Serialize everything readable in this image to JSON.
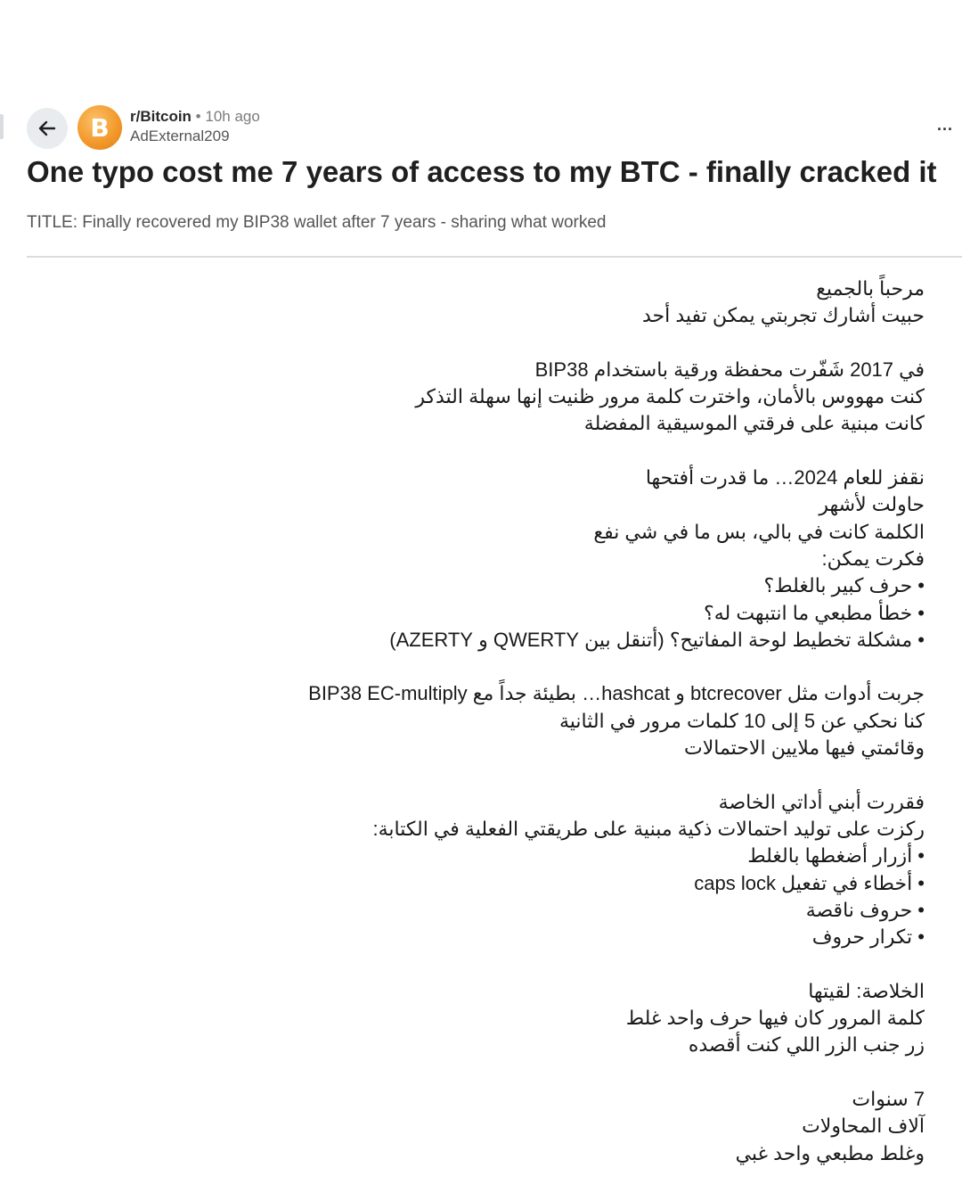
{
  "header": {
    "subreddit": "r/Bitcoin",
    "separator": " • ",
    "time_ago": "10h ago",
    "author": "AdExternal209",
    "avatar_letter": "B",
    "more_label": "..."
  },
  "post": {
    "title": "One typo cost me 7 years of access to my BTC - finally cracked it",
    "subtitle": "TITLE: Finally recovered my BIP38 wallet after 7 years - sharing what worked",
    "paragraphs": [
      [
        "مرحباً بالجميع",
        "حبيت أشارك تجربتي يمكن تفيد أحد"
      ],
      [
        "في 2017 شَفّرت محفظة ورقية باستخدام BIP38",
        "كنت مهووس بالأمان، واخترت كلمة مرور ظنيت إنها سهلة التذكر",
        "كانت مبنية على فرقتي الموسيقية المفضلة"
      ],
      [
        "نقفز للعام 2024… ما قدرت أفتحها",
        "حاولت لأشهر",
        "الكلمة كانت في بالي، بس ما في شي نفع",
        "فكرت يمكن:",
        "• حرف كبير بالغلط؟",
        "• خطأ مطبعي ما انتبهت له؟",
        "• مشكلة تخطيط لوحة المفاتيح؟ (أتنقل بين QWERTY و AZERTY)"
      ],
      [
        "جربت أدوات مثل btcrecover و hashcat… بطيئة جداً مع BIP38 EC-multiply",
        "كنا نحكي عن 5 إلى 10 كلمات مرور في الثانية",
        "وقائمتي فيها ملايين الاحتمالات"
      ],
      [
        "فقررت أبني أداتي الخاصة",
        "ركزت على توليد احتمالات ذكية مبنية على طريقتي الفعلية في الكتابة:",
        "• أزرار أضغطها بالغلط",
        "• أخطاء في تفعيل caps lock",
        "• حروف ناقصة",
        "• تكرار حروف"
      ],
      [
        "الخلاصة: لقيتها",
        "كلمة المرور كان فيها حرف واحد غلط",
        "زر جنب الزر اللي كنت أقصده"
      ],
      [
        "7 سنوات",
        "آلاف المحاولات",
        "وغلط مطبعي واحد غبي"
      ]
    ]
  }
}
